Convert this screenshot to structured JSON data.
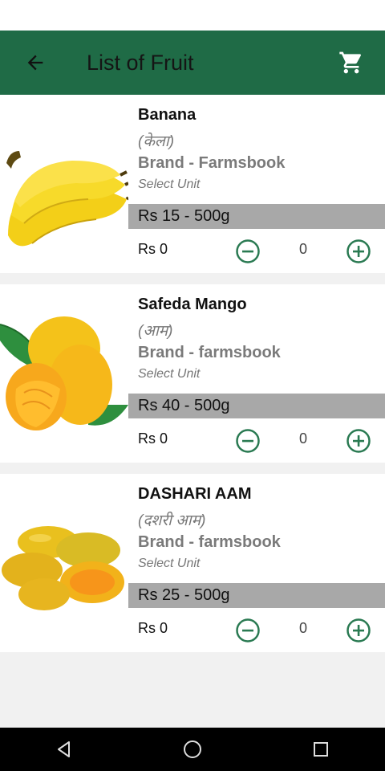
{
  "header": {
    "title": "List of Fruit",
    "back_icon": "arrow-back-icon",
    "cart_icon": "shopping-cart-icon",
    "bar_color": "#1f6b46"
  },
  "products": [
    {
      "name": "Banana",
      "local_name": "(केला)",
      "brand": "Brand - Farmsbook",
      "unit_label": "Select Unit",
      "price": "Rs 15 - 500g",
      "total": "Rs 0",
      "quantity": "0"
    },
    {
      "name": "Safeda Mango",
      "local_name": "(आम)",
      "brand": "Brand - farmsbook",
      "unit_label": "Select Unit",
      "price": "Rs 40 - 500g",
      "total": "Rs 0",
      "quantity": "0"
    },
    {
      "name": "DASHARI AAM",
      "local_name": "(दशरी आम)",
      "brand": "Brand - farmsbook",
      "unit_label": "Select Unit",
      "price": "Rs 25 - 500g",
      "total": "Rs 0",
      "quantity": "0"
    }
  ],
  "controls": {
    "minus_icon": "minus-circle-icon",
    "plus_icon": "plus-circle-icon",
    "accent": "#2a7a52"
  },
  "navigation": {
    "back": "nav-back-icon",
    "home": "nav-home-icon",
    "recents": "nav-recents-icon"
  }
}
